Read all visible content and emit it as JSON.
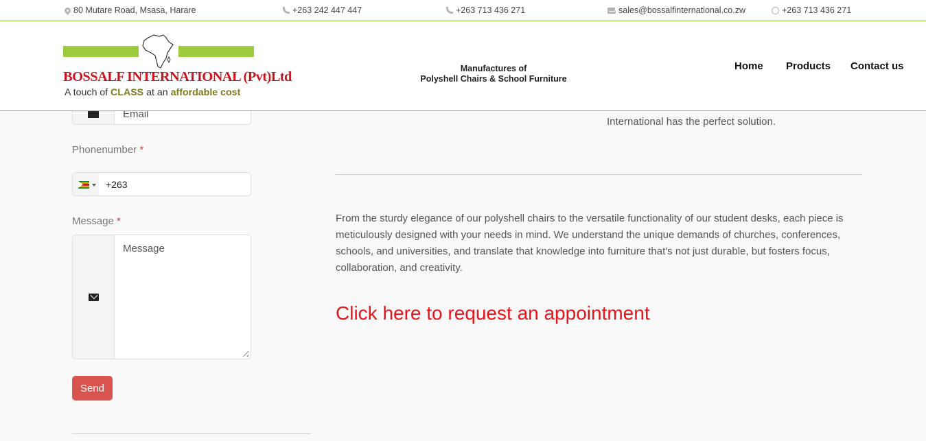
{
  "topbar": {
    "address": "80 Mutare Road, Msasa, Harare",
    "phone1": "+263 242 447 447",
    "phone2": "+263 713 436 271",
    "email": "sales@bossalfinternational.co.zw",
    "whatsapp": "+263 713 436 271",
    "icons": [
      "map-pin-icon",
      "phone-icon",
      "phone-icon",
      "mail-icon",
      "whatsapp-icon"
    ],
    "accent": "#8dc63f"
  },
  "logo": {
    "name": "BOSSALF INTERNATIONAL (Pvt)Ltd",
    "tagline_pre": "A touch of ",
    "tagline_class": "CLASS",
    "tagline_mid": " at an ",
    "tagline_affordable": "affordable cost",
    "colors": {
      "bar": "#9ccc3c",
      "name": "#c8181e",
      "emphasis": "#7a7a1e"
    }
  },
  "header": {
    "headline_line1": "Manufactures of",
    "headline_line2": "Polyshell Chairs & School Furniture"
  },
  "nav": {
    "home": "Home",
    "products": "Products",
    "contact": "Contact us"
  },
  "form": {
    "email_value": "Email",
    "phone_label": "Phonenumber",
    "phone_value": "+263",
    "message_label": "Message",
    "message_value": "Message",
    "required_mark": "*",
    "send_label": "Send",
    "send_color": "#d9534f"
  },
  "content": {
    "intro_tail": "International has the perfect solution.",
    "paragraph": "From the sturdy elegance of our polyshell chairs to the versatile functionality of our student desks, each piece is meticulously designed with your needs in mind. We understand the unique demands of churches, conferences, schools, and universities, and translate that knowledge into furniture that's not just durable, but fosters focus, collaboration, and creativity.",
    "cta": "Click here to request an appointment",
    "cta_color": "#e8141c"
  }
}
